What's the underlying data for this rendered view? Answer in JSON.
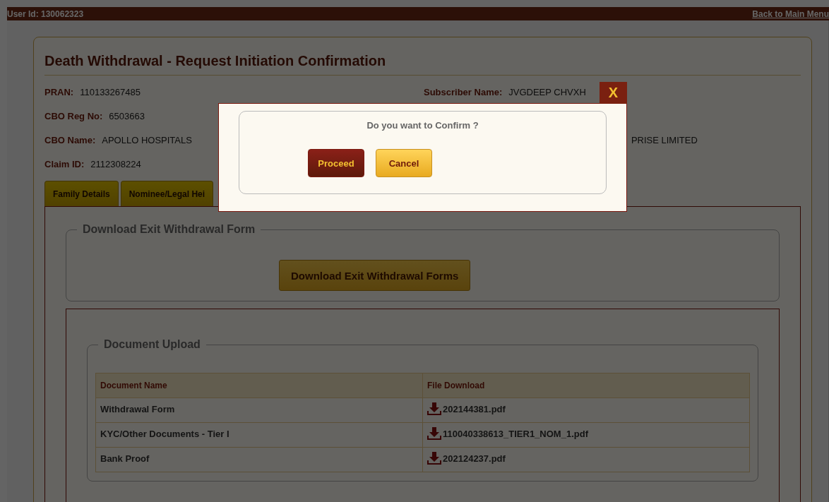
{
  "top_bar": {
    "user_id": "User Id: 130062323",
    "back_link": "Back to Main Menu"
  },
  "page": {
    "title": "Death Withdrawal - Request Initiation Confirmation",
    "fields_left": [
      {
        "label": "PRAN:",
        "value": "110133267485"
      },
      {
        "label": "CBO Reg No:",
        "value": "6503663"
      },
      {
        "label": "CBO Name:",
        "value": "APOLLO HOSPITALS",
        "value_tail": "PRISE LIMITED"
      },
      {
        "label": "Claim ID:",
        "value": "2112308224"
      }
    ],
    "fields_right": [
      {
        "label": "Subscriber Name:",
        "value": "JVGDEEP CHVXH"
      }
    ],
    "tabs": [
      {
        "label": "Family Details",
        "selected": false
      },
      {
        "label": "Nominee/Legal Hei",
        "selected": false
      }
    ],
    "download_section": {
      "legend": "Download Exit Withdrawal Form",
      "button": "Download Exit Withdrawal Forms"
    },
    "upload_section": {
      "legend": "Document Upload",
      "columns": [
        "Document Name",
        "File Download"
      ],
      "rows": [
        {
          "document": "Withdrawal Form",
          "file": "202144381.pdf"
        },
        {
          "document": "KYC/Other Documents - Tier I",
          "file": "110040338613_TIER1_NOM_1.pdf"
        },
        {
          "document": "Bank Proof",
          "file": "202124237.pdf"
        }
      ]
    }
  },
  "dialog": {
    "close": "X",
    "message": "Do you want to Confirm ?",
    "buttons": [
      {
        "label": "Proceed",
        "kind": "primary"
      },
      {
        "label": "Cancel",
        "kind": "secondary"
      }
    ]
  }
}
